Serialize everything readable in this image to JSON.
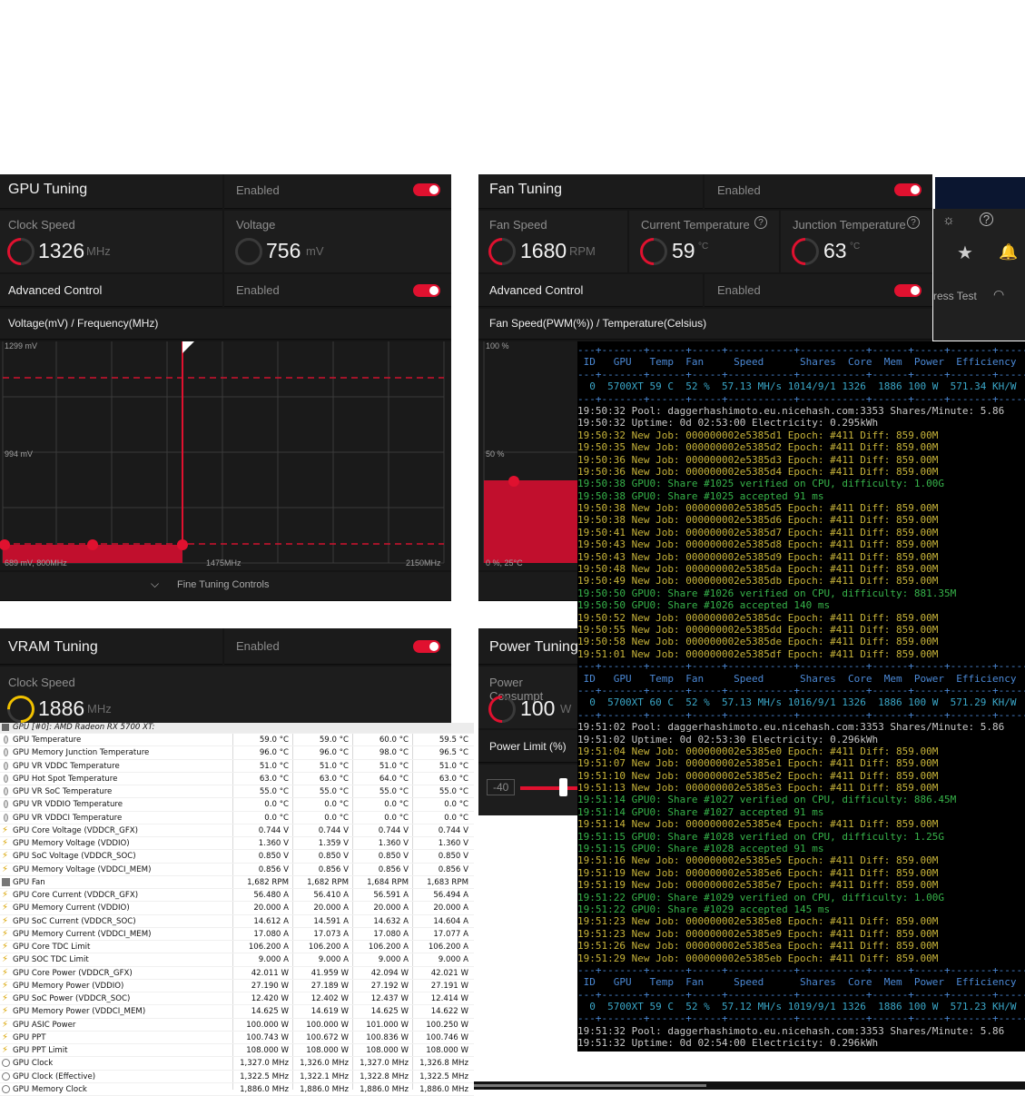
{
  "gpu_tuning": {
    "title": "GPU Tuning",
    "enabled": "Enabled",
    "clock_label": "Clock Speed",
    "clock_value": "1326",
    "clock_unit": "MHz",
    "voltage_label": "Voltage",
    "voltage_value": "756",
    "voltage_unit": "mV",
    "advanced_label": "Advanced Control",
    "advanced_enabled": "Enabled",
    "curve_title": "Voltage(mV) / Frequency(MHz)",
    "y_top": "1299 mV",
    "y_mid": "994 mV",
    "x_min": "689 mV, 800MHz",
    "x_mid": "1475MHz",
    "x_max": "2150MHz",
    "fine_tuning": "Fine Tuning Controls"
  },
  "fan_tuning": {
    "title": "Fan Tuning",
    "enabled": "Enabled",
    "fan_speed_label": "Fan Speed",
    "fan_speed_value": "1680",
    "fan_speed_unit": "RPM",
    "cur_temp_label": "Current Temperature",
    "cur_temp_value": "59",
    "cur_temp_unit": "°C",
    "junc_temp_label": "Junction Temperature",
    "junc_temp_value": "63",
    "junc_temp_unit": "°C",
    "advanced_label": "Advanced Control",
    "advanced_enabled": "Enabled",
    "curve_title": "Fan Speed(PWM(%)) / Temperature(Celsius)",
    "y_top": "100 %",
    "y_mid": "50 %",
    "x_min": "0 %, 25°C"
  },
  "vram_tuning": {
    "title": "VRAM Tuning",
    "enabled": "Enabled",
    "clock_label": "Clock Speed",
    "clock_value": "1886",
    "clock_unit": "MHz"
  },
  "power_tuning": {
    "title": "Power Tuning",
    "consump_label": "Power Consumpt",
    "consump_value": "100",
    "consump_unit": "W",
    "limit_label": "Power Limit (%)",
    "limit_min": "-40"
  },
  "topbar": {
    "stress_test": "ress Test"
  },
  "terminal": {
    "lines": [
      {
        "c": "c-blue",
        "t": "---+-------+------+-----+-----------+-----------+------+-----+-------+------------"
      },
      {
        "c": "c-blue",
        "t": " ID   GPU   Temp  Fan     Speed      Shares  Core  Mem  Power  Efficiency"
      },
      {
        "c": "c-blue",
        "t": "---+-------+------+-----+-----------+-----------+------+-----+-------+------------"
      },
      {
        "c": "c-cyan",
        "t": "  0  5700XT 59 C  52 %  57.13 MH/s 1014/9/1 1326  1886 100 W  571.34 KH/W"
      },
      {
        "c": "c-blue",
        "t": "---+-------+------+-----+-----------+-----------+------+-----+-------+------------"
      },
      {
        "c": "c-wht",
        "t": "19:50:32 Pool: daggerhashimoto.eu.nicehash.com:3353 Shares/Minute: 5.86"
      },
      {
        "c": "c-wht",
        "t": "19:50:32 Uptime: 0d 02:53:00 Electricity: 0.295kWh"
      },
      {
        "c": "c-yel",
        "t": "19:50:32 New Job: 000000002e5385d1 Epoch: #411 Diff: 859.00M"
      },
      {
        "c": "c-yel",
        "t": "19:50:35 New Job: 000000002e5385d2 Epoch: #411 Diff: 859.00M"
      },
      {
        "c": "c-yel",
        "t": "19:50:36 New Job: 000000002e5385d3 Epoch: #411 Diff: 859.00M"
      },
      {
        "c": "c-yel",
        "t": "19:50:36 New Job: 000000002e5385d4 Epoch: #411 Diff: 859.00M"
      },
      {
        "c": "c-grn",
        "t": "19:50:38 GPU0: Share #1025 verified on CPU, difficulty: 1.00G"
      },
      {
        "c": "c-grn",
        "t": "19:50:38 GPU0: Share #1025 accepted 91 ms"
      },
      {
        "c": "c-yel",
        "t": "19:50:38 New Job: 000000002e5385d5 Epoch: #411 Diff: 859.00M"
      },
      {
        "c": "c-yel",
        "t": "19:50:38 New Job: 000000002e5385d6 Epoch: #411 Diff: 859.00M"
      },
      {
        "c": "c-yel",
        "t": "19:50:41 New Job: 000000002e5385d7 Epoch: #411 Diff: 859.00M"
      },
      {
        "c": "c-yel",
        "t": "19:50:43 New Job: 000000002e5385d8 Epoch: #411 Diff: 859.00M"
      },
      {
        "c": "c-yel",
        "t": "19:50:43 New Job: 000000002e5385d9 Epoch: #411 Diff: 859.00M"
      },
      {
        "c": "c-yel",
        "t": "19:50:48 New Job: 000000002e5385da Epoch: #411 Diff: 859.00M"
      },
      {
        "c": "c-yel",
        "t": "19:50:49 New Job: 000000002e5385db Epoch: #411 Diff: 859.00M"
      },
      {
        "c": "c-grn",
        "t": "19:50:50 GPU0: Share #1026 verified on CPU, difficulty: 881.35M"
      },
      {
        "c": "c-grn",
        "t": "19:50:50 GPU0: Share #1026 accepted 140 ms"
      },
      {
        "c": "c-yel",
        "t": "19:50:52 New Job: 000000002e5385dc Epoch: #411 Diff: 859.00M"
      },
      {
        "c": "c-yel",
        "t": "19:50:55 New Job: 000000002e5385dd Epoch: #411 Diff: 859.00M"
      },
      {
        "c": "c-yel",
        "t": "19:50:58 New Job: 000000002e5385de Epoch: #411 Diff: 859.00M"
      },
      {
        "c": "c-yel",
        "t": "19:51:01 New Job: 000000002e5385df Epoch: #411 Diff: 859.00M"
      },
      {
        "c": "c-blue",
        "t": "---+-------+------+-----+-----------+-----------+------+-----+-------+------------"
      },
      {
        "c": "c-blue",
        "t": " ID   GPU   Temp  Fan     Speed      Shares  Core  Mem  Power  Efficiency"
      },
      {
        "c": "c-blue",
        "t": "---+-------+------+-----+-----------+-----------+------+-----+-------+------------"
      },
      {
        "c": "c-cyan",
        "t": "  0  5700XT 60 C  52 %  57.13 MH/s 1016/9/1 1326  1886 100 W  571.29 KH/W"
      },
      {
        "c": "c-blue",
        "t": "---+-------+------+-----+-----------+-----------+------+-----+-------+------------"
      },
      {
        "c": "c-wht",
        "t": "19:51:02 Pool: daggerhashimoto.eu.nicehash.com:3353 Shares/Minute: 5.86"
      },
      {
        "c": "c-wht",
        "t": "19:51:02 Uptime: 0d 02:53:30 Electricity: 0.296kWh"
      },
      {
        "c": "c-yel",
        "t": "19:51:04 New Job: 000000002e5385e0 Epoch: #411 Diff: 859.00M"
      },
      {
        "c": "c-yel",
        "t": "19:51:07 New Job: 000000002e5385e1 Epoch: #411 Diff: 859.00M"
      },
      {
        "c": "c-yel",
        "t": "19:51:10 New Job: 000000002e5385e2 Epoch: #411 Diff: 859.00M"
      },
      {
        "c": "c-yel",
        "t": "19:51:13 New Job: 000000002e5385e3 Epoch: #411 Diff: 859.00M"
      },
      {
        "c": "c-grn",
        "t": "19:51:14 GPU0: Share #1027 verified on CPU, difficulty: 886.45M"
      },
      {
        "c": "c-grn",
        "t": "19:51:14 GPU0: Share #1027 accepted 91 ms"
      },
      {
        "c": "c-yel",
        "t": "19:51:14 New Job: 000000002e5385e4 Epoch: #411 Diff: 859.00M"
      },
      {
        "c": "c-grn",
        "t": "19:51:15 GPU0: Share #1028 verified on CPU, difficulty: 1.25G"
      },
      {
        "c": "c-grn",
        "t": "19:51:15 GPU0: Share #1028 accepted 91 ms"
      },
      {
        "c": "c-yel",
        "t": "19:51:16 New Job: 000000002e5385e5 Epoch: #411 Diff: 859.00M"
      },
      {
        "c": "c-yel",
        "t": "19:51:19 New Job: 000000002e5385e6 Epoch: #411 Diff: 859.00M"
      },
      {
        "c": "c-yel",
        "t": "19:51:19 New Job: 000000002e5385e7 Epoch: #411 Diff: 859.00M"
      },
      {
        "c": "c-grn",
        "t": "19:51:22 GPU0: Share #1029 verified on CPU, difficulty: 1.00G"
      },
      {
        "c": "c-grn",
        "t": "19:51:22 GPU0: Share #1029 accepted 145 ms"
      },
      {
        "c": "c-yel",
        "t": "19:51:23 New Job: 000000002e5385e8 Epoch: #411 Diff: 859.00M"
      },
      {
        "c": "c-yel",
        "t": "19:51:23 New Job: 000000002e5385e9 Epoch: #411 Diff: 859.00M"
      },
      {
        "c": "c-yel",
        "t": "19:51:26 New Job: 000000002e5385ea Epoch: #411 Diff: 859.00M"
      },
      {
        "c": "c-yel",
        "t": "19:51:29 New Job: 000000002e5385eb Epoch: #411 Diff: 859.00M"
      },
      {
        "c": "c-blue",
        "t": "---+-------+------+-----+-----------+-----------+------+-----+-------+------------"
      },
      {
        "c": "c-blue",
        "t": " ID   GPU   Temp  Fan     Speed      Shares  Core  Mem  Power  Efficiency"
      },
      {
        "c": "c-blue",
        "t": "---+-------+------+-----+-----------+-----------+------+-----+-------+------------"
      },
      {
        "c": "c-cyan",
        "t": "  0  5700XT 59 C  52 %  57.12 MH/s 1019/9/1 1326  1886 100 W  571.23 KH/W"
      },
      {
        "c": "c-blue",
        "t": "---+-------+------+-----+-----------+-----------+------+-----+-------+------------"
      },
      {
        "c": "c-wht",
        "t": "19:51:32 Pool: daggerhashimoto.eu.nicehash.com:3353 Shares/Minute: 5.86"
      },
      {
        "c": "c-wht",
        "t": "19:51:32 Uptime: 0d 02:54:00 Electricity: 0.296kWh"
      }
    ]
  },
  "hwinfo": {
    "group": "GPU [#0]: AMD Radeon RX 5700 XT:",
    "rows": [
      {
        "icon": "temp",
        "name": "GPU Temperature",
        "v": [
          "59.0 °C",
          "59.0 °C",
          "60.0 °C",
          "59.5 °C"
        ]
      },
      {
        "icon": "temp",
        "name": "GPU Memory Junction Temperature",
        "v": [
          "96.0 °C",
          "96.0 °C",
          "98.0 °C",
          "96.5 °C"
        ]
      },
      {
        "icon": "temp",
        "name": "GPU VR VDDC Temperature",
        "v": [
          "51.0 °C",
          "51.0 °C",
          "51.0 °C",
          "51.0 °C"
        ]
      },
      {
        "icon": "temp",
        "name": "GPU Hot Spot Temperature",
        "v": [
          "63.0 °C",
          "63.0 °C",
          "64.0 °C",
          "63.0 °C"
        ]
      },
      {
        "icon": "temp",
        "name": "GPU VR SoC Temperature",
        "v": [
          "55.0 °C",
          "55.0 °C",
          "55.0 °C",
          "55.0 °C"
        ]
      },
      {
        "icon": "temp",
        "name": "GPU VR VDDIO Temperature",
        "v": [
          "0.0 °C",
          "0.0 °C",
          "0.0 °C",
          "0.0 °C"
        ]
      },
      {
        "icon": "temp",
        "name": "GPU VR VDDCI Temperature",
        "v": [
          "0.0 °C",
          "0.0 °C",
          "0.0 °C",
          "0.0 °C"
        ]
      },
      {
        "icon": "volt",
        "name": "GPU Core Voltage (VDDCR_GFX)",
        "v": [
          "0.744 V",
          "0.744 V",
          "0.744 V",
          "0.744 V"
        ]
      },
      {
        "icon": "volt",
        "name": "GPU Memory Voltage (VDDIO)",
        "v": [
          "1.360 V",
          "1.359 V",
          "1.360 V",
          "1.360 V"
        ]
      },
      {
        "icon": "volt",
        "name": "GPU SoC Voltage (VDDCR_SOC)",
        "v": [
          "0.850 V",
          "0.850 V",
          "0.850 V",
          "0.850 V"
        ]
      },
      {
        "icon": "volt",
        "name": "GPU Memory Voltage (VDDCI_MEM)",
        "v": [
          "0.856 V",
          "0.856 V",
          "0.856 V",
          "0.856 V"
        ]
      },
      {
        "icon": "fan",
        "name": "GPU Fan",
        "v": [
          "1,682 RPM",
          "1,682 RPM",
          "1,684 RPM",
          "1,683 RPM"
        ]
      },
      {
        "icon": "volt",
        "name": "GPU Core Current (VDDCR_GFX)",
        "v": [
          "56.480 A",
          "56.410 A",
          "56.591 A",
          "56.494 A"
        ]
      },
      {
        "icon": "volt",
        "name": "GPU Memory Current (VDDIO)",
        "v": [
          "20.000 A",
          "20.000 A",
          "20.000 A",
          "20.000 A"
        ]
      },
      {
        "icon": "volt",
        "name": "GPU SoC Current (VDDCR_SOC)",
        "v": [
          "14.612 A",
          "14.591 A",
          "14.632 A",
          "14.604 A"
        ]
      },
      {
        "icon": "volt",
        "name": "GPU Memory Current (VDDCI_MEM)",
        "v": [
          "17.080 A",
          "17.073 A",
          "17.080 A",
          "17.077 A"
        ]
      },
      {
        "icon": "volt",
        "name": "GPU Core TDC Limit",
        "v": [
          "106.200 A",
          "106.200 A",
          "106.200 A",
          "106.200 A"
        ]
      },
      {
        "icon": "volt",
        "name": "GPU SOC TDC Limit",
        "v": [
          "9.000 A",
          "9.000 A",
          "9.000 A",
          "9.000 A"
        ]
      },
      {
        "icon": "volt",
        "name": "GPU Core Power (VDDCR_GFX)",
        "v": [
          "42.011 W",
          "41.959 W",
          "42.094 W",
          "42.021 W"
        ]
      },
      {
        "icon": "volt",
        "name": "GPU Memory Power (VDDIO)",
        "v": [
          "27.190 W",
          "27.189 W",
          "27.192 W",
          "27.191 W"
        ]
      },
      {
        "icon": "volt",
        "name": "GPU SoC Power (VDDCR_SOC)",
        "v": [
          "12.420 W",
          "12.402 W",
          "12.437 W",
          "12.414 W"
        ]
      },
      {
        "icon": "volt",
        "name": "GPU Memory Power (VDDCI_MEM)",
        "v": [
          "14.625 W",
          "14.619 W",
          "14.625 W",
          "14.622 W"
        ]
      },
      {
        "icon": "volt",
        "name": "GPU ASIC Power",
        "v": [
          "100.000 W",
          "100.000 W",
          "101.000 W",
          "100.250 W"
        ]
      },
      {
        "icon": "volt",
        "name": "GPU PPT",
        "v": [
          "100.743 W",
          "100.672 W",
          "100.836 W",
          "100.746 W"
        ]
      },
      {
        "icon": "volt",
        "name": "GPU PPT Limit",
        "v": [
          "108.000 W",
          "108.000 W",
          "108.000 W",
          "108.000 W"
        ]
      },
      {
        "icon": "clock",
        "name": "GPU Clock",
        "v": [
          "1,327.0 MHz",
          "1,326.0 MHz",
          "1,327.0 MHz",
          "1,326.8 MHz"
        ]
      },
      {
        "icon": "clock",
        "name": "GPU Clock (Effective)",
        "v": [
          "1,322.5 MHz",
          "1,322.1 MHz",
          "1,322.8 MHz",
          "1,322.5 MHz"
        ]
      },
      {
        "icon": "clock",
        "name": "GPU Memory Clock",
        "v": [
          "1,886.0 MHz",
          "1,886.0 MHz",
          "1,886.0 MHz",
          "1,886.0 MHz"
        ]
      }
    ]
  }
}
